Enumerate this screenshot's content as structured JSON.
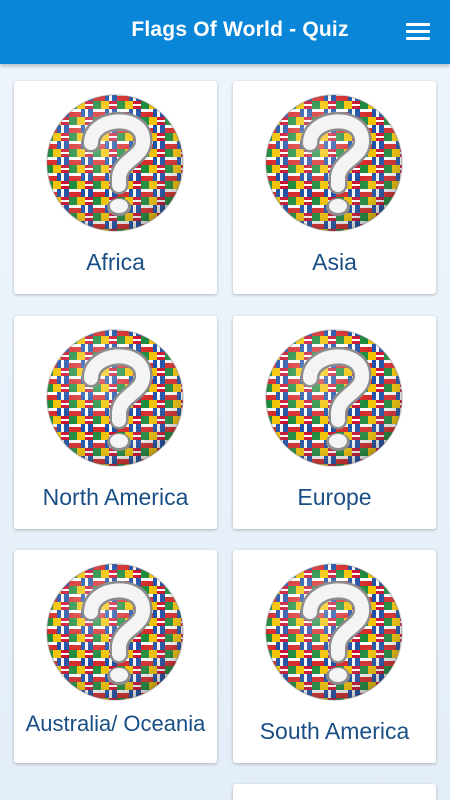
{
  "header": {
    "title": "Flags Of World - Quiz",
    "menu_icon": "hamburger-menu-icon"
  },
  "colors": {
    "header_bg": "#0a86d9",
    "label_text": "#1a4f86",
    "card_bg": "#ffffff"
  },
  "cards": [
    {
      "label": "Africa",
      "icon": "flag-globe-question-icon"
    },
    {
      "label": "Asia",
      "icon": "flag-globe-question-icon"
    },
    {
      "label": "North America",
      "icon": "flag-globe-question-icon"
    },
    {
      "label": "Europe",
      "icon": "flag-globe-question-icon"
    },
    {
      "label": "Australia/ Oceania",
      "icon": "flag-globe-question-icon"
    },
    {
      "label": "South America",
      "icon": "flag-globe-question-icon"
    }
  ]
}
